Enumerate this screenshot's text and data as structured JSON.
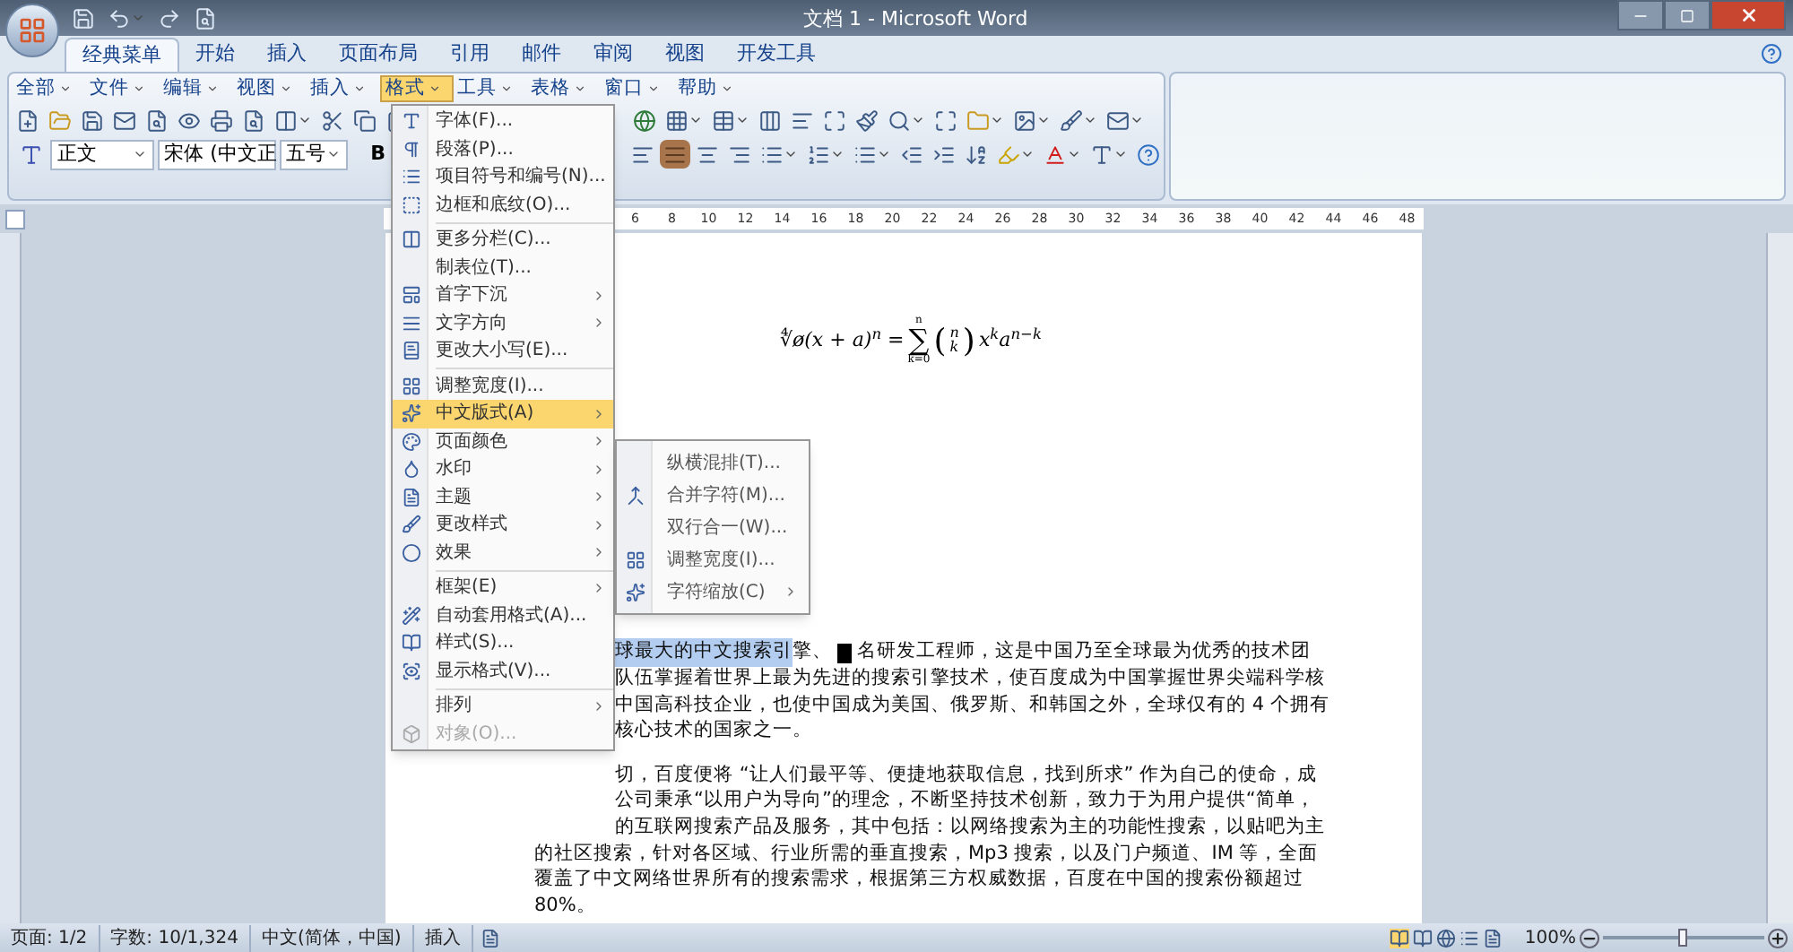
{
  "window": {
    "title": "文档 1 - Microsoft Word"
  },
  "ribbon_tabs": [
    {
      "label": "经典菜单",
      "selected": true
    },
    {
      "label": "开始",
      "selected": false
    },
    {
      "label": "插入",
      "selected": false
    },
    {
      "label": "页面布局",
      "selected": false
    },
    {
      "label": "引用",
      "selected": false
    },
    {
      "label": "邮件",
      "selected": false
    },
    {
      "label": "审阅",
      "selected": false
    },
    {
      "label": "视图",
      "selected": false
    },
    {
      "label": "开发工具",
      "selected": false
    }
  ],
  "classic_menu": [
    {
      "label": "全部",
      "selected": false
    },
    {
      "label": "文件",
      "selected": false
    },
    {
      "label": "编辑",
      "selected": false
    },
    {
      "label": "视图",
      "selected": false
    },
    {
      "label": "插入",
      "selected": false
    },
    {
      "label": "格式",
      "selected": true
    },
    {
      "label": "工具",
      "selected": false
    },
    {
      "label": "表格",
      "selected": false
    },
    {
      "label": "窗口",
      "selected": false
    },
    {
      "label": "帮助",
      "selected": false
    }
  ],
  "format_bar": {
    "style": "正文",
    "font": "宋体 (中文正",
    "size": "五号",
    "bold": "B"
  },
  "format_menu": [
    {
      "kind": "command",
      "label": "字体(F)...",
      "submenu": false,
      "disabled": false,
      "selected": false
    },
    {
      "kind": "command",
      "label": "段落(P)...",
      "submenu": false,
      "disabled": false,
      "selected": false
    },
    {
      "kind": "command",
      "label": "项目符号和编号(N)...",
      "submenu": false,
      "disabled": false,
      "selected": false
    },
    {
      "kind": "command",
      "label": "边框和底纹(O)...",
      "submenu": false,
      "disabled": false,
      "selected": false
    },
    {
      "kind": "separator"
    },
    {
      "kind": "command",
      "label": "更多分栏(C)...",
      "submenu": false,
      "disabled": false,
      "selected": false
    },
    {
      "kind": "command",
      "label": "制表位(T)...",
      "submenu": false,
      "disabled": false,
      "selected": false
    },
    {
      "kind": "command",
      "label": "首字下沉",
      "submenu": true,
      "disabled": false,
      "selected": false
    },
    {
      "kind": "command",
      "label": "文字方向",
      "submenu": true,
      "disabled": false,
      "selected": false
    },
    {
      "kind": "command",
      "label": "更改大小写(E)...",
      "submenu": false,
      "disabled": false,
      "selected": false
    },
    {
      "kind": "separator"
    },
    {
      "kind": "command",
      "label": "调整宽度(I)...",
      "submenu": false,
      "disabled": false,
      "selected": false
    },
    {
      "kind": "command",
      "label": "中文版式(A)",
      "submenu": true,
      "disabled": false,
      "selected": true
    },
    {
      "kind": "command",
      "label": "页面颜色",
      "submenu": true,
      "disabled": false,
      "selected": false
    },
    {
      "kind": "command",
      "label": "水印",
      "submenu": true,
      "disabled": false,
      "selected": false
    },
    {
      "kind": "command",
      "label": "主题",
      "submenu": true,
      "disabled": false,
      "selected": false
    },
    {
      "kind": "command",
      "label": "更改样式",
      "submenu": true,
      "disabled": false,
      "selected": false
    },
    {
      "kind": "command",
      "label": "效果",
      "submenu": true,
      "disabled": false,
      "selected": false
    },
    {
      "kind": "separator"
    },
    {
      "kind": "command",
      "label": "框架(E)",
      "submenu": true,
      "disabled": false,
      "selected": false
    },
    {
      "kind": "command",
      "label": "自动套用格式(A)...",
      "submenu": false,
      "disabled": false,
      "selected": false
    },
    {
      "kind": "command",
      "label": "样式(S)...",
      "submenu": false,
      "disabled": false,
      "selected": false
    },
    {
      "kind": "command",
      "label": "显示格式(V)...",
      "submenu": false,
      "disabled": false,
      "selected": false
    },
    {
      "kind": "separator"
    },
    {
      "kind": "command",
      "label": "排列",
      "submenu": true,
      "disabled": false,
      "selected": false
    },
    {
      "kind": "command",
      "label": "对象(O)...",
      "submenu": false,
      "disabled": true,
      "selected": false
    }
  ],
  "chinese_layout_submenu": [
    {
      "label": "纵横混排(T)...",
      "submenu": false
    },
    {
      "label": "合并字符(M)...",
      "submenu": false
    },
    {
      "label": "双行合一(W)...",
      "submenu": false
    },
    {
      "label": "调整宽度(I)...",
      "submenu": false
    },
    {
      "label": "字符缩放(C)",
      "submenu": true
    }
  ],
  "ruler": {
    "numbers": [
      "6",
      "8",
      "10",
      "12",
      "14",
      "16",
      "18",
      "20",
      "22",
      "24",
      "26",
      "28",
      "30",
      "32",
      "34",
      "36",
      "38",
      "40",
      "42",
      "44",
      "46",
      "48"
    ]
  },
  "equation": {
    "lhs": "∜ø(x + a)$^{n}$ =",
    "sum_top": "n",
    "sum_sign": "∑",
    "sum_bottom": "k=0",
    "binom_open": "(",
    "binom_top": "n",
    "binom_bottom": "k",
    "binom_close": ")",
    "rhs": "x$^{k}$a$^{n−k}$"
  },
  "paragraphs": [
    {
      "lines": [
        {
          "indented": true,
          "segments": [
            {
              "kind": "text",
              "text": "球最大的中文搜索引",
              "selected": true
            },
            {
              "kind": "text",
              "text": "擎、",
              "selected": false
            },
            {
              "kind": "cursor"
            },
            {
              "kind": "text",
              "text": "名研发工程师，这是中国乃至全球最为优秀的技术团",
              "selected": false
            }
          ]
        },
        {
          "indented": true,
          "segments": [
            {
              "kind": "text",
              "text": "队伍掌握着世界上最为先进的搜索引擎技术，使百度成为中国掌握世界尖端科学核",
              "selected": false
            }
          ]
        },
        {
          "indented": true,
          "segments": [
            {
              "kind": "text",
              "text": "中国高科技企业，也使中国成为美国、俄罗斯、和韩国之外，全球仅有的 4 个拥有",
              "selected": false
            }
          ]
        },
        {
          "indented": true,
          "segments": [
            {
              "kind": "text",
              "text": "核心技术的国家之一。",
              "selected": false
            }
          ]
        }
      ]
    },
    {
      "lines": [
        {
          "indented": true,
          "segments": [
            {
              "kind": "text",
              "text": "切，百度便将 “让人们最平等、便捷地获取信息，找到所求” 作为自己的使命，成",
              "selected": false
            }
          ]
        },
        {
          "indented": true,
          "segments": [
            {
              "kind": "text",
              "text": "公司秉承“以用户为导向”的理念，不断坚持技术创新，致力于为用户提供“简单，",
              "selected": false
            }
          ]
        },
        {
          "indented": true,
          "segments": [
            {
              "kind": "text",
              "text": "的互联网搜索产品及服务，其中包括：以网络搜索为主的功能性搜索，以贴吧为主",
              "selected": false
            }
          ]
        },
        {
          "indented": false,
          "segments": [
            {
              "kind": "text",
              "text": "的社区搜索，针对各区域、行业所需的垂直搜索，Mp3 搜索，以及门户频道、IM 等，全面",
              "selected": false
            }
          ]
        },
        {
          "indented": false,
          "segments": [
            {
              "kind": "text",
              "text": "覆盖了中文网络世界所有的搜索需求，根据第三方权威数据，百度在中国的搜索份额超过",
              "selected": false
            }
          ]
        },
        {
          "indented": false,
          "segments": [
            {
              "kind": "text",
              "text": "80%。",
              "selected": false
            }
          ]
        }
      ]
    }
  ],
  "status_bar": {
    "items": [
      "页面: 1/2",
      "字数: 10/1,324",
      "中文(简体，中国)",
      "插入"
    ],
    "zoom": "100%",
    "zoom_level": {
      "level": 0.5
    }
  }
}
